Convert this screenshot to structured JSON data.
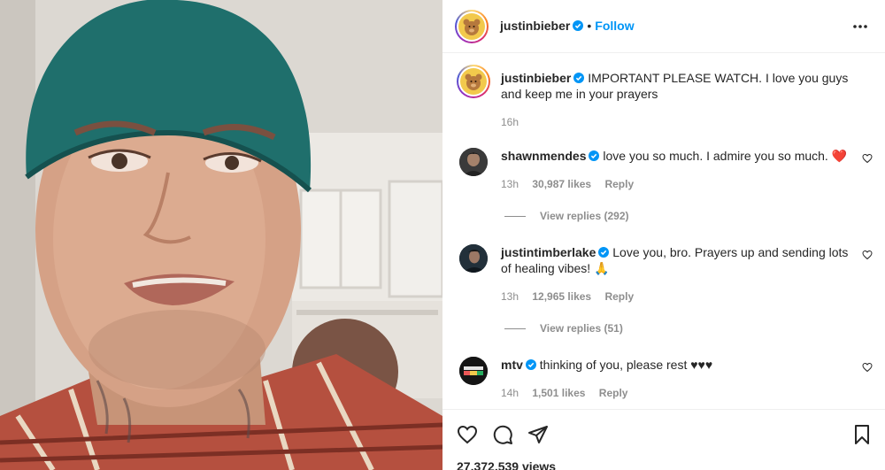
{
  "post": {
    "username": "justinbieber",
    "follow_label": "Follow",
    "dot": "•"
  },
  "caption": {
    "username": "justinbieber",
    "text": "IMPORTANT PLEASE WATCH. I love you guys and keep me in your prayers",
    "time": "16h"
  },
  "comments": [
    {
      "username": "shawnmendes",
      "text": "love you so much. I admire you so much. ❤️",
      "time": "13h",
      "likes": "30,987 likes",
      "reply_label": "Reply",
      "view_replies": "View replies (292)"
    },
    {
      "username": "justintimberlake",
      "text": "Love you, bro. Prayers up and sending lots of healing vibes! 🙏",
      "time": "13h",
      "likes": "12,965 likes",
      "reply_label": "Reply",
      "view_replies": "View replies (51)"
    },
    {
      "username": "mtv",
      "text": "thinking of you, please rest ♥♥♥",
      "time": "14h",
      "likes": "1,501 likes",
      "reply_label": "Reply"
    }
  ],
  "footer": {
    "views": "27,372,539 views"
  },
  "icons": {
    "more": "more-options-icon",
    "heart": "heart-icon",
    "comment": "comment-icon",
    "share": "share-icon",
    "save": "bookmark-icon",
    "verified": "verified-badge-icon"
  },
  "colors": {
    "accent": "#0095f6",
    "text": "#262626",
    "muted": "#8e8e8e",
    "verified": "#0095f6"
  }
}
